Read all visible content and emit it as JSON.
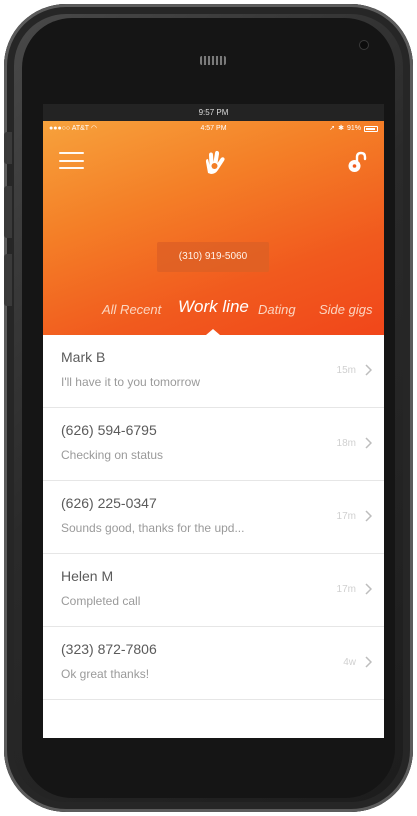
{
  "screen": {
    "top_caption": "9:57 PM"
  },
  "statusbar": {
    "carrier": "AT&T",
    "time": "4:57 PM",
    "battery": "91%"
  },
  "header": {
    "phone_number": "(310) 919-5060",
    "tabs": [
      "All Recent",
      "Work line",
      "Dating",
      "Side gigs"
    ],
    "active_tab": "Work line",
    "accent": "#f15a1e"
  },
  "conversations": [
    {
      "name": "Mark B",
      "preview": "I'll have it to you tomorrow",
      "time": "15m"
    },
    {
      "name": "(626) 594-6795",
      "preview": "Checking on status",
      "time": "18m"
    },
    {
      "name": "(626) 225-0347",
      "preview": "Sounds good, thanks for the upd...",
      "time": "17m"
    },
    {
      "name": "Helen M",
      "preview": "Completed call",
      "time": "17m"
    },
    {
      "name": "(323) 872-7806",
      "preview": "Ok great thanks!",
      "time": "4w"
    }
  ],
  "icons": {
    "menu": "hamburger-menu-icon",
    "logo": "hand-logo-icon",
    "lock": "padlock-open-icon",
    "chevron": "chevron-right-icon"
  }
}
